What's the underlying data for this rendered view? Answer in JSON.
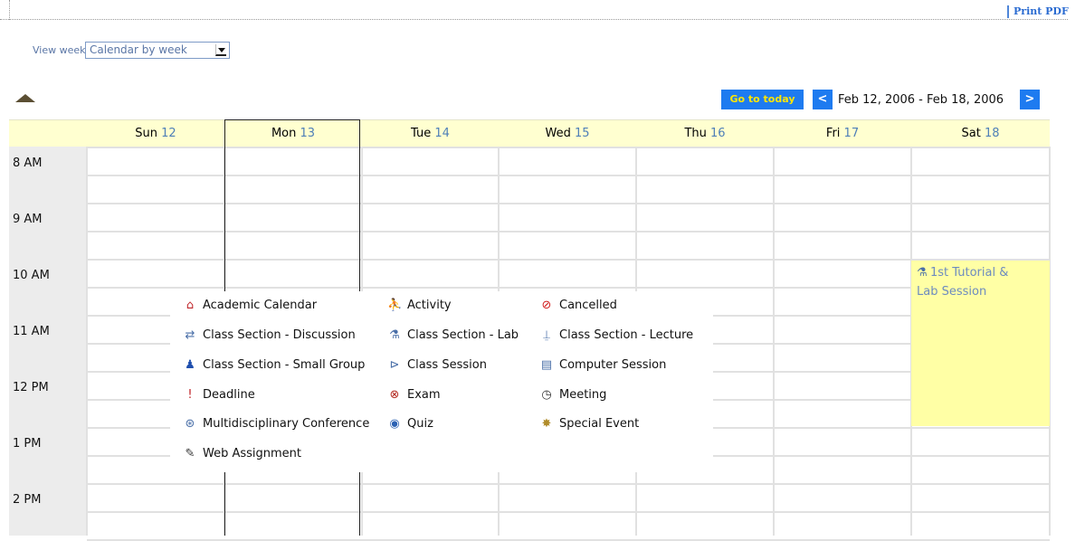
{
  "print_pdf": "Print PDF",
  "view_week": {
    "label": "View week:",
    "selected": "Calendar by week"
  },
  "nav": {
    "today": "Go to today",
    "prev": "<",
    "next": ">",
    "range": "Feb 12, 2006 - Feb 18, 2006"
  },
  "days": [
    {
      "name": "Sun",
      "num": "12"
    },
    {
      "name": "Mon",
      "num": "13"
    },
    {
      "name": "Tue",
      "num": "14"
    },
    {
      "name": "Wed",
      "num": "15"
    },
    {
      "name": "Thu",
      "num": "16"
    },
    {
      "name": "Fri",
      "num": "17"
    },
    {
      "name": "Sat",
      "num": "18"
    }
  ],
  "hours": [
    "8 AM",
    "9 AM",
    "10 AM",
    "11 AM",
    "12 PM",
    "1 PM",
    "2 PM"
  ],
  "event": {
    "title_line1": "1st Tutorial &",
    "title_line2": "Lab Session",
    "icon": "flask-icon"
  },
  "legend": [
    {
      "label": "Academic Calendar",
      "icon": "house-icon",
      "color": "#c0262b"
    },
    {
      "label": "Activity",
      "icon": "runner-icon",
      "color": "#4a6fa8"
    },
    {
      "label": "Cancelled",
      "icon": "no-entry-icon",
      "color": "#d11a1a"
    },
    {
      "label": "Class Section - Discussion",
      "icon": "arrows-exchange-icon",
      "color": "#4a6fa8"
    },
    {
      "label": "Class Section - Lab",
      "icon": "flask-icon",
      "color": "#4a6fa8"
    },
    {
      "label": "Class Section - Lecture",
      "icon": "lectern-icon",
      "color": "#4a6fa8"
    },
    {
      "label": "Class Section - Small Group",
      "icon": "group-icon",
      "color": "#1f4fae"
    },
    {
      "label": "Class Session",
      "icon": "projector-icon",
      "color": "#4a6fa8"
    },
    {
      "label": "Computer Session",
      "icon": "computer-icon",
      "color": "#4a6fa8"
    },
    {
      "label": "Deadline",
      "icon": "exclamation-icon",
      "color": "#c0262b"
    },
    {
      "label": "Exam",
      "icon": "x-circle-icon",
      "color": "#b3271c"
    },
    {
      "label": "Meeting",
      "icon": "clock-icon",
      "color": "#333333"
    },
    {
      "label": "Multidisciplinary Conference",
      "icon": "conference-icon",
      "color": "#4a6fa8"
    },
    {
      "label": "Quiz",
      "icon": "quiz-icon",
      "color": "#2c62b3"
    },
    {
      "label": "Special Event",
      "icon": "party-icon",
      "color": "#b08c2a"
    },
    {
      "label": "Web Assignment",
      "icon": "edit-page-icon",
      "color": "#333333"
    }
  ],
  "colors": {
    "header_bg": "#ffffd0",
    "event_bg": "#ffffa5",
    "button_bg": "#1e7bf0",
    "today_text": "#ffe600"
  }
}
